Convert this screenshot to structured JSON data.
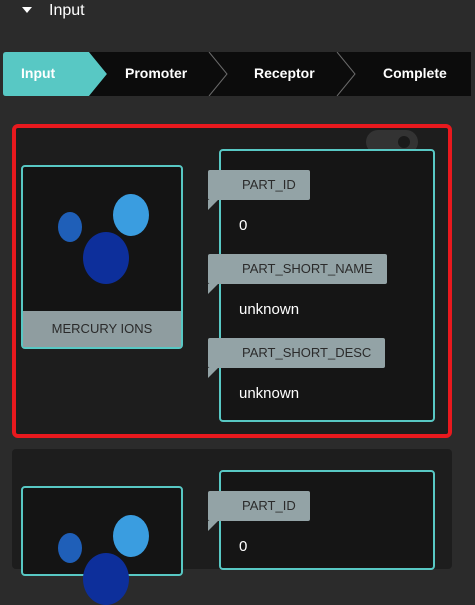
{
  "header": {
    "title": "Input"
  },
  "steps": [
    "Input",
    "Promoter",
    "Receptor",
    "Complete"
  ],
  "colors": {
    "accent": "#58c8c4",
    "highlight": "#e8191e",
    "tag": "#93a3a6"
  },
  "part": {
    "image_caption": "MERCURY IONS",
    "fields": [
      {
        "label": "PART_ID",
        "value": "0"
      },
      {
        "label": "PART_SHORT_NAME",
        "value": "unknown"
      },
      {
        "label": "PART_SHORT_DESC",
        "value": "unknown"
      }
    ]
  },
  "part2": {
    "fields": [
      {
        "label": "PART_ID",
        "value": "0"
      }
    ]
  }
}
